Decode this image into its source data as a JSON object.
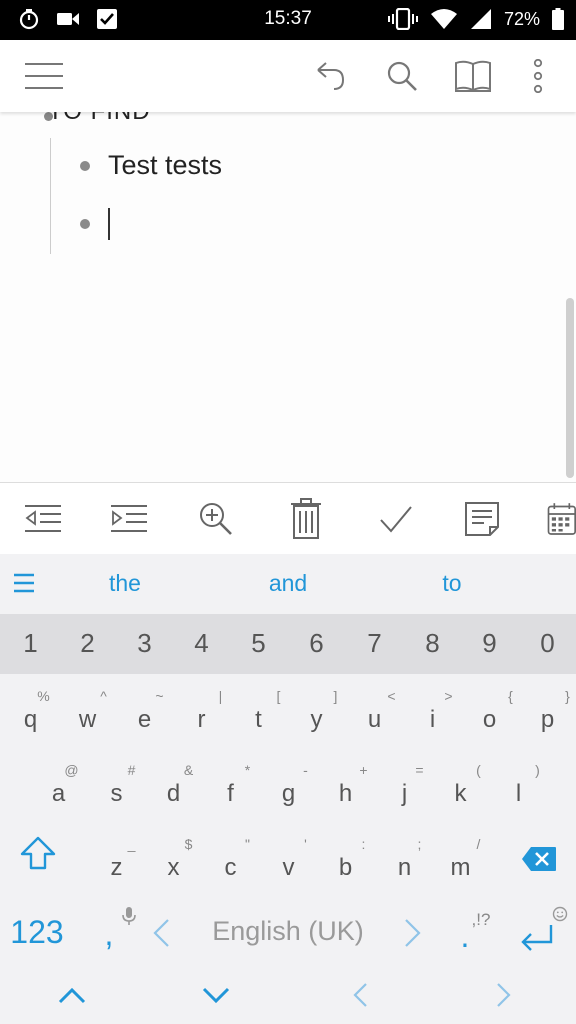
{
  "status_bar": {
    "time": "15:37",
    "battery": "72%",
    "icons": [
      "stopwatch-icon",
      "video-camera-icon",
      "checkbox-icon",
      "vibrate-icon",
      "wifi-icon",
      "signal-icon",
      "battery-icon"
    ]
  },
  "app_toolbar": {
    "icons": [
      "menu-icon",
      "undo-icon",
      "search-icon",
      "book-icon",
      "more-icon"
    ]
  },
  "document": {
    "partial_heading": "TO FIND",
    "items": [
      {
        "text": "Test tests"
      },
      {
        "text": ""
      }
    ]
  },
  "edit_toolbar": {
    "icons": [
      "outdent-icon",
      "indent-icon",
      "zoom-in-icon",
      "trash-icon",
      "check-icon",
      "note-icon",
      "calendar-icon"
    ]
  },
  "keyboard": {
    "suggestions": [
      "the",
      "and",
      "to"
    ],
    "number_row": [
      "1",
      "2",
      "3",
      "4",
      "5",
      "6",
      "7",
      "8",
      "9",
      "0"
    ],
    "row1": {
      "keys": [
        "q",
        "w",
        "e",
        "r",
        "t",
        "y",
        "u",
        "i",
        "o",
        "p"
      ],
      "hints": [
        "%",
        "^",
        "~",
        "|",
        "[",
        "]",
        "<",
        ">",
        "{",
        "}"
      ]
    },
    "row2": {
      "keys": [
        "a",
        "s",
        "d",
        "f",
        "g",
        "h",
        "j",
        "k",
        "l"
      ],
      "hints": [
        "@",
        "#",
        "&",
        "*",
        "-",
        "+",
        "=",
        "(",
        ")"
      ]
    },
    "row3": {
      "keys": [
        "z",
        "x",
        "c",
        "v",
        "b",
        "n",
        "m"
      ],
      "hints": [
        "_",
        "$",
        "\"",
        "'",
        ":",
        ";",
        "/"
      ]
    },
    "mode_key": "123",
    "comma_key": ",",
    "space_label": "English (UK)",
    "period_key": ".",
    "period_hint": ",!?",
    "colors": {
      "accent": "#2196d8",
      "key_text": "#555555",
      "hint_text": "#888888"
    }
  }
}
